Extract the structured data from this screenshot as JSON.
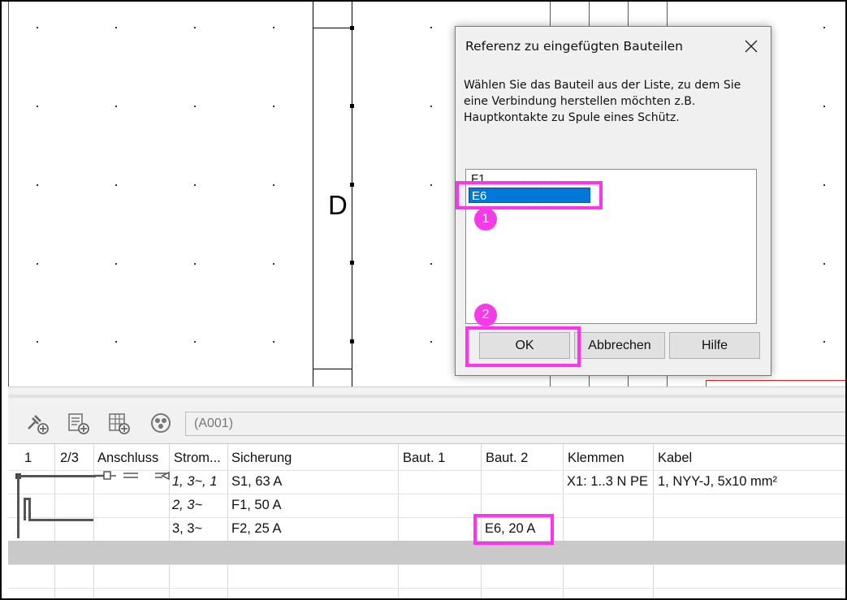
{
  "canvas": {
    "letter": "D"
  },
  "toolbar": {
    "icons": [
      "connect-add-icon",
      "sheet-add-icon",
      "grid-add-icon",
      "circuit-icon"
    ],
    "input_value": "(A001)"
  },
  "grid": {
    "headers": [
      "1",
      "2/3",
      "Anschluss",
      "Strom...",
      "Sicherung",
      "Baut. 1",
      "Baut. 2",
      "Klemmen",
      "Kabel"
    ],
    "rows": [
      {
        "strom": "1, 3~, 1",
        "sicherung": "S1, 63 A",
        "baut1": "",
        "baut2": "",
        "klemmen": "X1: 1..3 N PE",
        "kabel": "1, NYY-J, 5x10 mm²"
      },
      {
        "strom": "2, 3~",
        "sicherung": "F1, 50 A",
        "baut1": "",
        "baut2": "",
        "klemmen": "",
        "kabel": ""
      },
      {
        "strom": "3, 3~",
        "sicherung": "F2, 25 A",
        "baut1": "",
        "baut2": "E6, 20 A",
        "klemmen": "",
        "kabel": ""
      }
    ]
  },
  "dialog": {
    "title": "Referenz zu eingefügten Bauteilen",
    "description": "Wählen Sie das Bauteil aus der Liste, zu dem Sie eine Verbindung herstellen möchten z.B. Hauptkontakte zu Spule eines Schütz.",
    "items": [
      "F1",
      "E6"
    ],
    "selected": "E6",
    "buttons": {
      "ok": "OK",
      "cancel": "Abbrechen",
      "help": "Hilfe"
    }
  },
  "annotations": {
    "badge1": "1",
    "badge2": "2"
  },
  "colors": {
    "highlight": "#ff33ee",
    "selection": "#0078d7",
    "wire": "#d22222"
  }
}
